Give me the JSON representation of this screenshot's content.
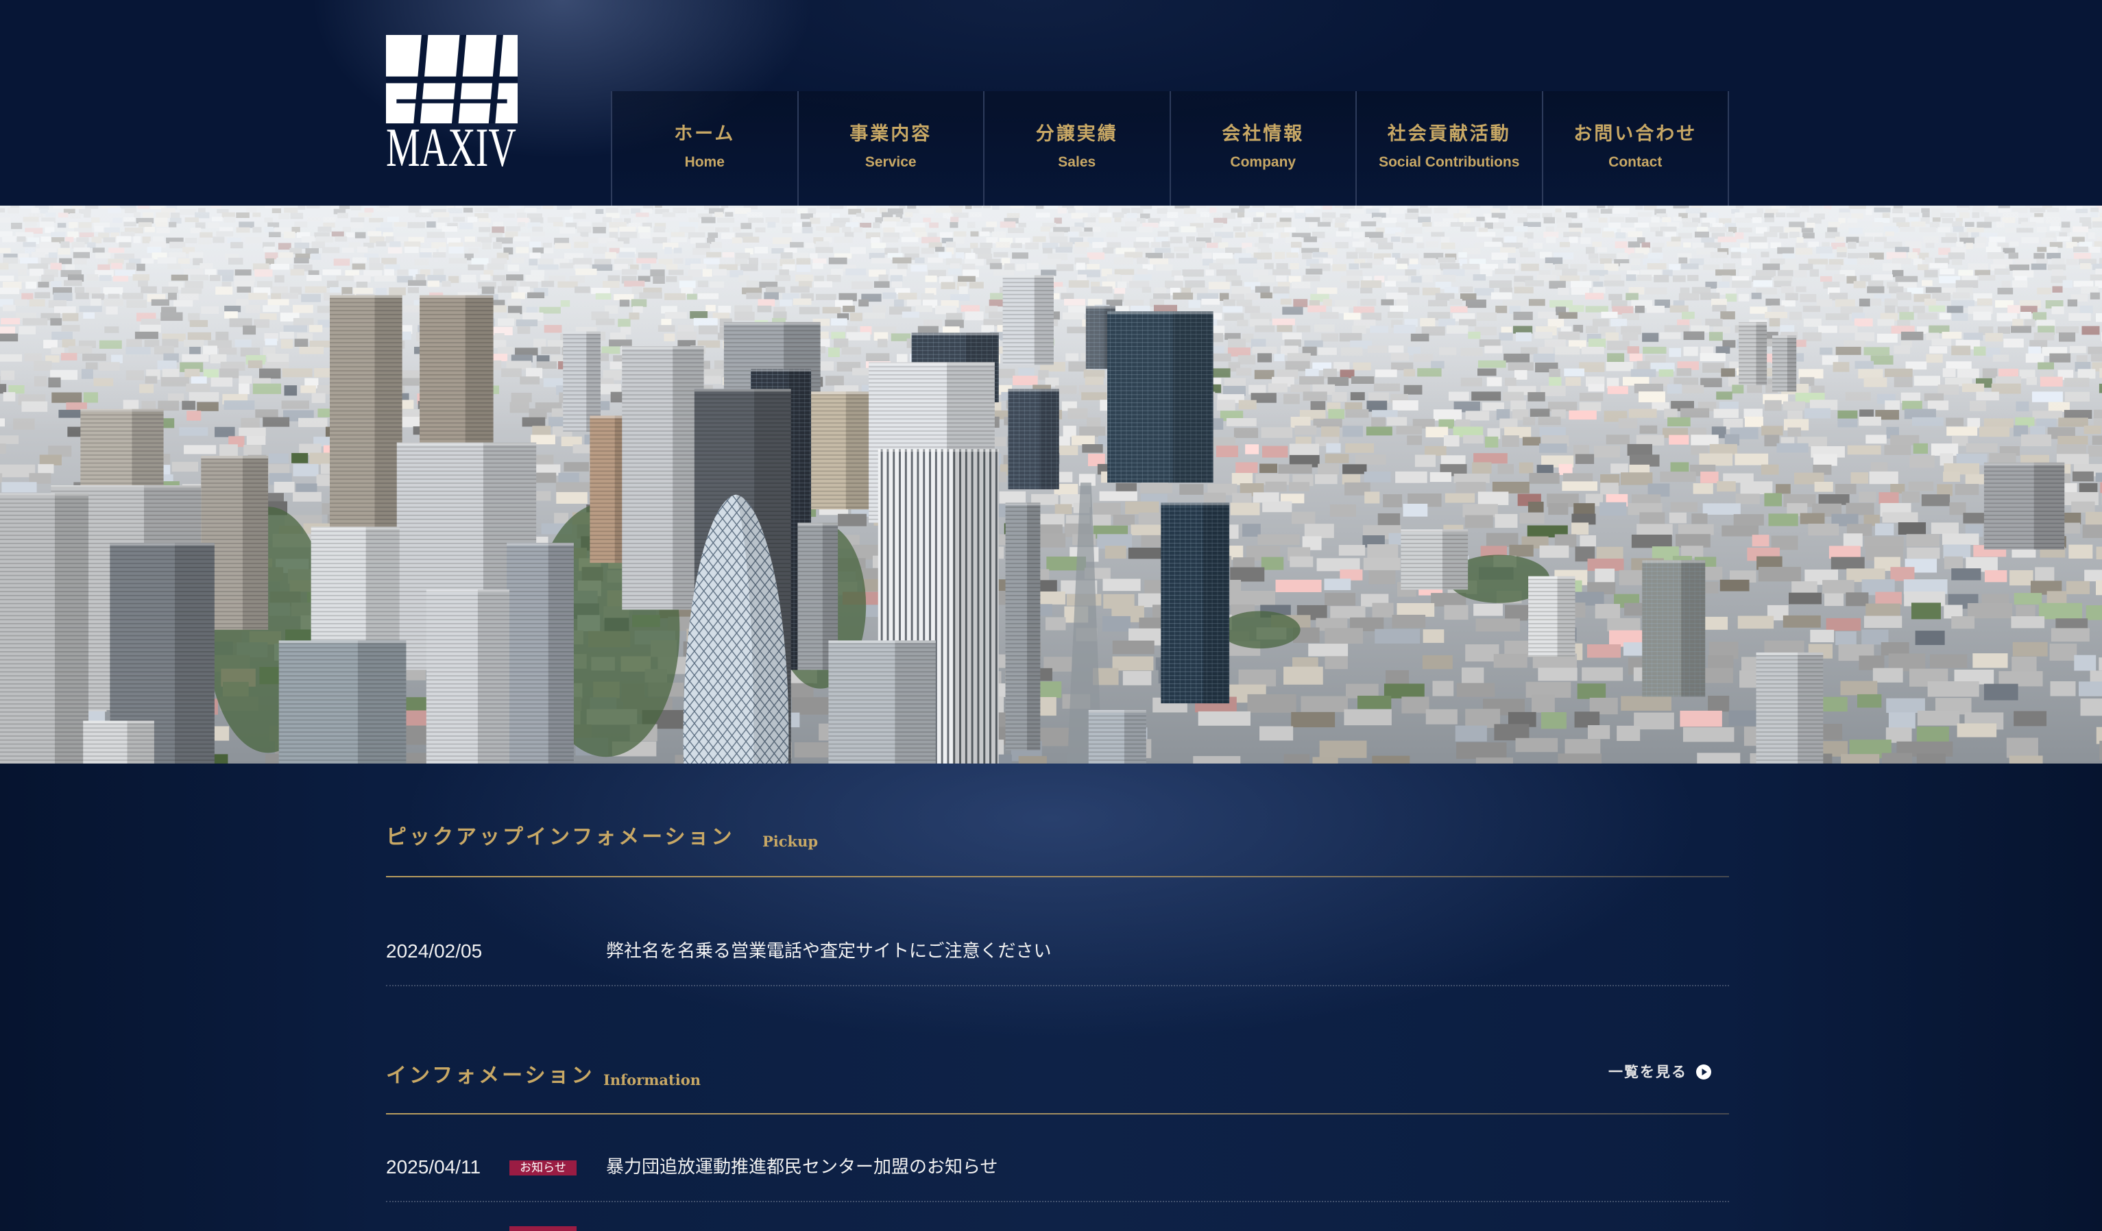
{
  "header": {
    "logo_text": "MAXIV",
    "nav": [
      {
        "ja": "ホーム",
        "en": "Home"
      },
      {
        "ja": "事業内容",
        "en": "Service"
      },
      {
        "ja": "分譲実績",
        "en": "Sales"
      },
      {
        "ja": "会社情報",
        "en": "Company"
      },
      {
        "ja": "社会貢献活動",
        "en": "Social Contributions"
      },
      {
        "ja": "お問い合わせ",
        "en": "Contact"
      }
    ]
  },
  "pickup": {
    "title": "ピックアップインフォメーション",
    "subtitle": "Pickup",
    "items": [
      {
        "date": "2024/02/05",
        "text": "弊社名を名乗る営業電話や査定サイトにご注意ください"
      }
    ]
  },
  "information": {
    "title": "インフォメーション",
    "subtitle": "Information",
    "more_label": "一覧を見る",
    "items": [
      {
        "date": "2025/04/11",
        "badge": "お知らせ",
        "text": "暴力団追放運動推進都民センター加盟のお知らせ"
      }
    ]
  },
  "icons": {
    "logo": "maxiv-logo-mark",
    "more": "circle-arrow-right-icon"
  },
  "colors": {
    "background": "#081838",
    "gold": "#c8a865",
    "badge": "#9a1c43",
    "text": "#f2f2f2"
  }
}
